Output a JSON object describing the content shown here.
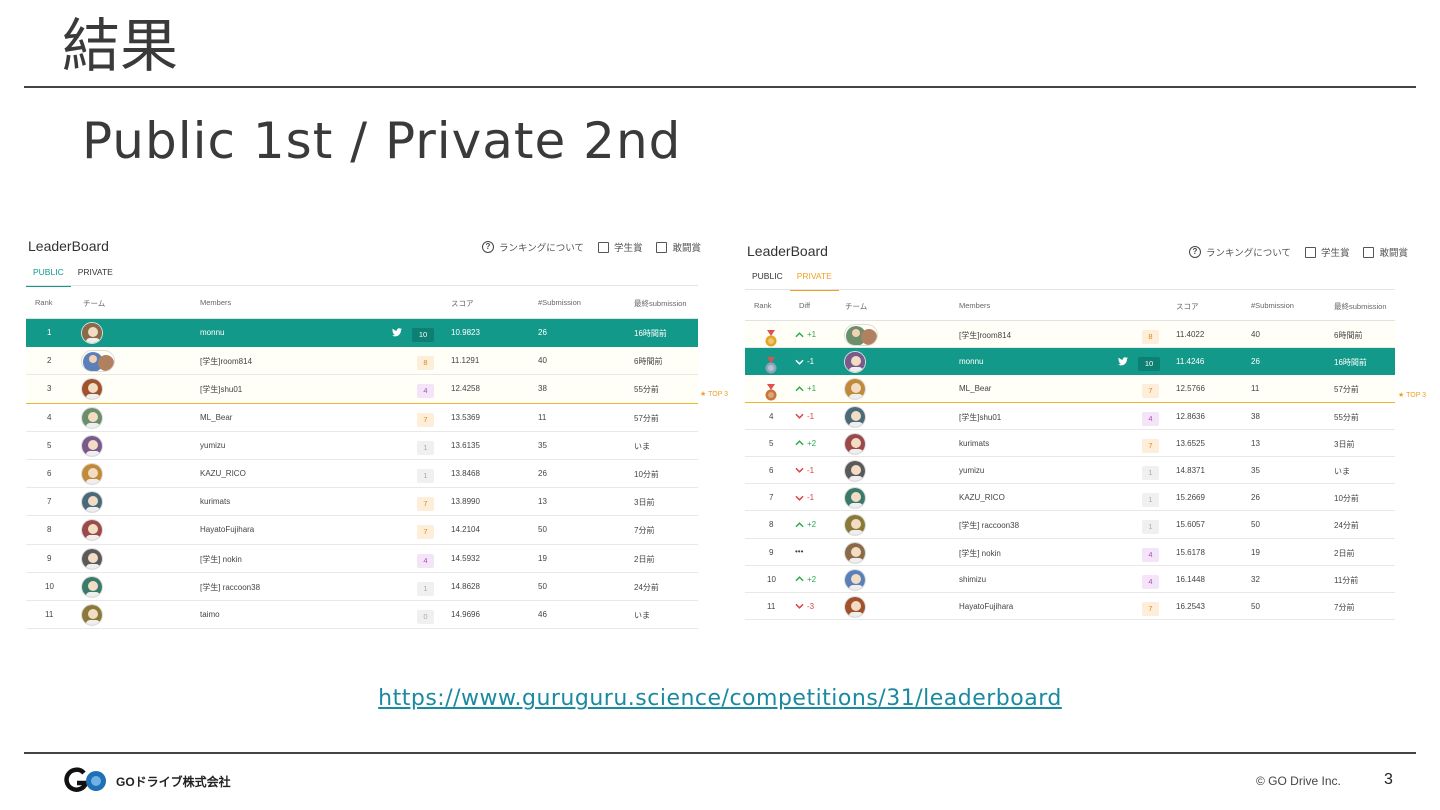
{
  "slide": {
    "title": "結果",
    "subtitle": "Public 1st / Private 2nd",
    "url": "https://www.guruguru.science/competitions/31/leaderboard",
    "company": "GOドライブ株式会社",
    "copyright": "© GO Drive Inc.",
    "page": "3"
  },
  "colors": {
    "accent": "#12998a",
    "public_tab": "#12998a",
    "private_tab": "#f0a020",
    "top3_line": "#f2b232"
  },
  "left": {
    "title": "LeaderBoard",
    "about": "ランキングについて",
    "student_award": "学生賞",
    "fight_award": "敢闘賞",
    "tabs": [
      "PUBLIC",
      "PRIVATE"
    ],
    "active_tab": "PUBLIC",
    "top3_label": "★ TOP 3",
    "headers": {
      "rank": "Rank",
      "team": "チーム",
      "members": "Members",
      "score": "スコア",
      "submissions": "#Submission",
      "last": "最終submission"
    },
    "rows": [
      {
        "rank": "1",
        "name": "monnu",
        "badge": "10",
        "score": "10.9823",
        "subs": "26",
        "last": "16時間前"
      },
      {
        "rank": "2",
        "name": "[学生]room814",
        "badge": "8",
        "score": "11.1291",
        "subs": "40",
        "last": "6時間前"
      },
      {
        "rank": "3",
        "name": "[学生]shu01",
        "badge": "4",
        "score": "12.4258",
        "subs": "38",
        "last": "55分前"
      },
      {
        "rank": "4",
        "name": "ML_Bear",
        "badge": "7",
        "score": "13.5369",
        "subs": "11",
        "last": "57分前"
      },
      {
        "rank": "5",
        "name": "yumizu",
        "badge": "1",
        "score": "13.6135",
        "subs": "35",
        "last": "いま"
      },
      {
        "rank": "6",
        "name": "KAZU_RICO",
        "badge": "1",
        "score": "13.8468",
        "subs": "26",
        "last": "10分前"
      },
      {
        "rank": "7",
        "name": "kurimats",
        "badge": "7",
        "score": "13.8990",
        "subs": "13",
        "last": "3日前"
      },
      {
        "rank": "8",
        "name": "HayatoFujihara",
        "badge": "7",
        "score": "14.2104",
        "subs": "50",
        "last": "7分前"
      },
      {
        "rank": "9",
        "name": "[学生] nokin",
        "badge": "4",
        "score": "14.5932",
        "subs": "19",
        "last": "2日前"
      },
      {
        "rank": "10",
        "name": "[学生] raccoon38",
        "badge": "1",
        "score": "14.8628",
        "subs": "50",
        "last": "24分前"
      },
      {
        "rank": "11",
        "name": "taimo",
        "badge": "0",
        "score": "14.9696",
        "subs": "46",
        "last": "いま"
      }
    ]
  },
  "right": {
    "title": "LeaderBoard",
    "about": "ランキングについて",
    "student_award": "学生賞",
    "fight_award": "敢闘賞",
    "tabs": [
      "PUBLIC",
      "PRIVATE"
    ],
    "active_tab": "PRIVATE",
    "top3_label": "★ TOP 3",
    "headers": {
      "rank": "Rank",
      "diff": "Diff",
      "team": "チーム",
      "members": "Members",
      "score": "スコア",
      "submissions": "#Submission",
      "last": "最終submission"
    },
    "rows": [
      {
        "rank": "",
        "medal": "gold",
        "diff": "+1",
        "dir": "up",
        "name": "[学生]room814",
        "badge": "8",
        "score": "11.4022",
        "subs": "40",
        "last": "6時間前"
      },
      {
        "rank": "",
        "medal": "silver",
        "diff": "-1",
        "dir": "down",
        "name": "monnu",
        "badge": "10",
        "score": "11.4246",
        "subs": "26",
        "last": "16時間前"
      },
      {
        "rank": "",
        "medal": "bronze",
        "diff": "+1",
        "dir": "up",
        "name": "ML_Bear",
        "badge": "7",
        "score": "12.5766",
        "subs": "11",
        "last": "57分前"
      },
      {
        "rank": "4",
        "medal": "",
        "diff": "-1",
        "dir": "down",
        "name": "[学生]shu01",
        "badge": "4",
        "score": "12.8636",
        "subs": "38",
        "last": "55分前"
      },
      {
        "rank": "5",
        "medal": "",
        "diff": "+2",
        "dir": "up",
        "name": "kurimats",
        "badge": "7",
        "score": "13.6525",
        "subs": "13",
        "last": "3日前"
      },
      {
        "rank": "6",
        "medal": "",
        "diff": "-1",
        "dir": "down",
        "name": "yumizu",
        "badge": "1",
        "score": "14.8371",
        "subs": "35",
        "last": "いま"
      },
      {
        "rank": "7",
        "medal": "",
        "diff": "-1",
        "dir": "down",
        "name": "KAZU_RICO",
        "badge": "1",
        "score": "15.2669",
        "subs": "26",
        "last": "10分前"
      },
      {
        "rank": "8",
        "medal": "",
        "diff": "+2",
        "dir": "up",
        "name": "[学生] raccoon38",
        "badge": "1",
        "score": "15.6057",
        "subs": "50",
        "last": "24分前"
      },
      {
        "rank": "9",
        "medal": "",
        "diff": "•••",
        "dir": "same",
        "name": "[学生] nokin",
        "badge": "4",
        "score": "15.6178",
        "subs": "19",
        "last": "2日前"
      },
      {
        "rank": "10",
        "medal": "",
        "diff": "+2",
        "dir": "up",
        "name": "shimizu",
        "badge": "4",
        "score": "16.1448",
        "subs": "32",
        "last": "11分前"
      },
      {
        "rank": "11",
        "medal": "",
        "diff": "-3",
        "dir": "down",
        "name": "HayatoFujihara",
        "badge": "7",
        "score": "16.2543",
        "subs": "50",
        "last": "7分前"
      }
    ]
  }
}
